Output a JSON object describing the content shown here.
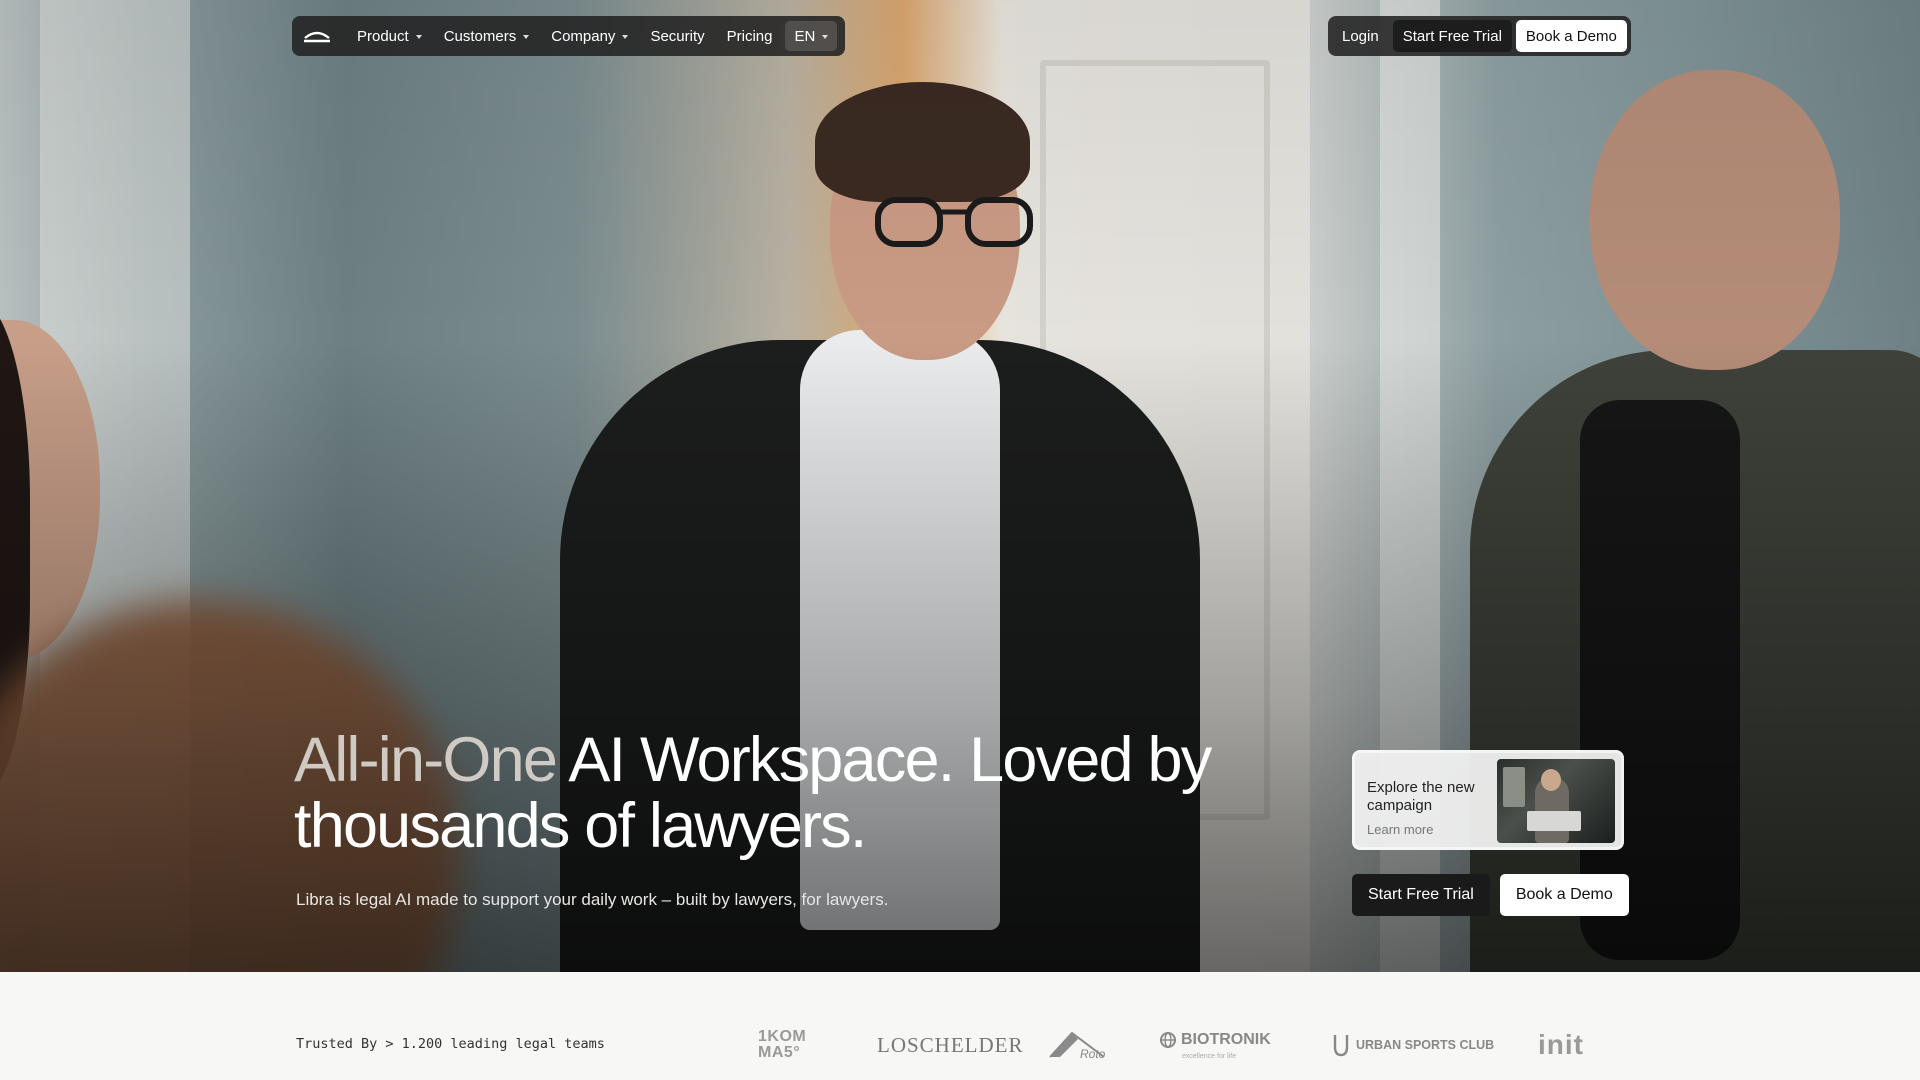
{
  "nav": {
    "items": [
      {
        "label": "Product",
        "has_dropdown": true
      },
      {
        "label": "Customers",
        "has_dropdown": true
      },
      {
        "label": "Company",
        "has_dropdown": true
      },
      {
        "label": "Security",
        "has_dropdown": false
      },
      {
        "label": "Pricing",
        "has_dropdown": false
      }
    ],
    "language": "EN",
    "login": "Login",
    "start_trial": "Start Free Trial",
    "book_demo": "Book a Demo"
  },
  "hero": {
    "headline_muted": "All-in-One",
    "headline_main": " AI Workspace. Loved by thousands of lawyers.",
    "subline": "Libra is legal AI made to support your daily work – built by lawyers, for lawyers.",
    "campaign": {
      "title": "Explore the new campaign",
      "link": "Learn more"
    },
    "cta_trial": "Start Free Trial",
    "cta_demo": "Book a Demo"
  },
  "trusted": {
    "text": "Trusted By > 1.200 leading legal teams",
    "logos": {
      "kom_line1": "1KOM",
      "kom_line2": "MA5°",
      "loschelder": "LOSCHELDER",
      "roto": "Roto",
      "biotronik": "BIOTRONIK",
      "biotronik_sub": "excellence for life",
      "usc": "URBAN SPORTS CLUB",
      "init": "init"
    }
  },
  "colors": {
    "nav_bg": "#222222",
    "cta_dark": "#1a1a1a",
    "cta_light": "#ffffff",
    "page_bg": "#f7f7f6"
  }
}
